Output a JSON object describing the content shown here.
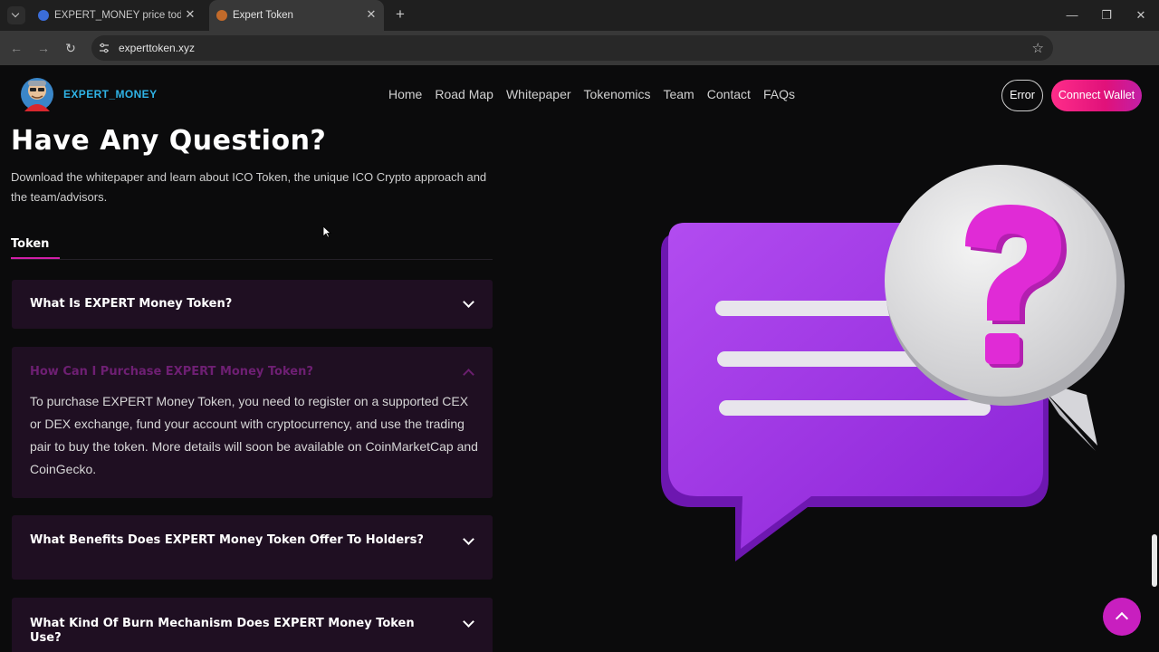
{
  "browser": {
    "tabs": [
      {
        "title": "EXPERT_MONEY price today, EX"
      },
      {
        "title": "Expert Token"
      }
    ],
    "url": "experttoken.xyz"
  },
  "site": {
    "brand": "EXPERT_MONEY",
    "nav": [
      "Home",
      "Road Map",
      "Whitepaper",
      "Tokenomics",
      "Team",
      "Contact",
      "FAQs"
    ],
    "error_label": "Error",
    "connect_label": "Connect Wallet"
  },
  "faq": {
    "title": "Have Any Question?",
    "subtitle": "Download the whitepaper and learn about ICO Token, the unique ICO Crypto approach and the team/advisors.",
    "tab": "Token",
    "items": [
      {
        "question": "What Is EXPERT Money Token?",
        "expanded": false
      },
      {
        "question": "How Can I Purchase EXPERT Money Token?",
        "expanded": true,
        "answer": "To purchase EXPERT Money Token, you need to register on a supported CEX or DEX exchange, fund your account with cryptocurrency, and use the trading pair to buy the token. More details will soon be available on CoinMarketCap and CoinGecko."
      },
      {
        "question": "What Benefits Does EXPERT Money Token Offer To Holders?",
        "expanded": false
      },
      {
        "question": "What Kind Of Burn Mechanism Does EXPERT Money Token Use?",
        "expanded": false
      }
    ]
  },
  "colors": {
    "accent": "#e0117a",
    "brand": "#2fb3e6",
    "faq_bg": "#1f0f22",
    "bubble_purple": "#a533e8",
    "question_mark": "#e02bd6"
  }
}
